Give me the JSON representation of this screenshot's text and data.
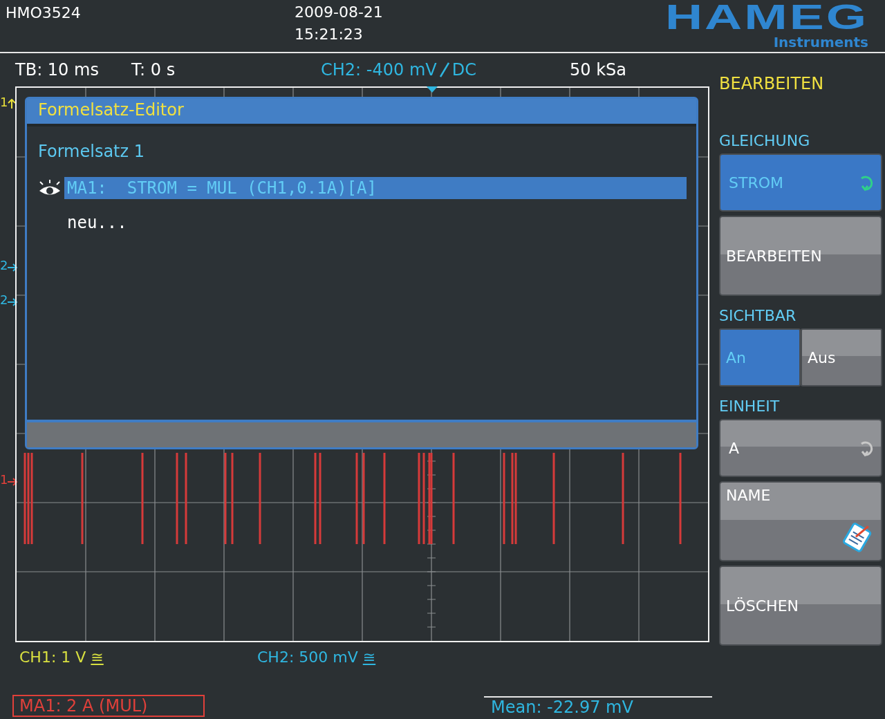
{
  "header": {
    "model": "HMO3524",
    "date": "2009-08-21",
    "time": "15:21:23",
    "logo": "HAMEG",
    "logo_sub": "Instruments"
  },
  "info": {
    "timebase": "TB: 10 ms",
    "trigger_time": "T: 0 s",
    "trigger_source": "CH2: -400 mV",
    "trigger_coupling": "DC",
    "sample_rate": "50 kSa"
  },
  "markers": [
    {
      "label": "1",
      "color": "#e8e03a",
      "kind": "up"
    },
    {
      "label": "2",
      "color": "#2fb6e0",
      "kind": "right"
    },
    {
      "label": "2",
      "color": "#2fb6e0",
      "kind": "right"
    },
    {
      "label": "1",
      "color": "#e2403a",
      "kind": "right"
    }
  ],
  "dialog": {
    "title": "Formelsatz-Editor",
    "group": "Formelsatz 1",
    "entries": [
      {
        "text": "MA1:  STROM = MUL (CH1,0.1A)[A]",
        "visible": true,
        "selected": true
      },
      {
        "text": "neu...",
        "visible": false,
        "selected": false
      }
    ]
  },
  "channels": [
    {
      "label": "CH1: 1 V",
      "coupling": "≅",
      "color": "#d8e040"
    },
    {
      "label": "CH2: 500 mV",
      "coupling": "≅",
      "color": "#2fb6e0"
    }
  ],
  "math": {
    "label": "MA1: 2 A (MUL)"
  },
  "measurement": {
    "label": "Mean: -22.97 mV"
  },
  "menu": {
    "title": "BEARBEITEN",
    "items": [
      {
        "kind": "select",
        "heading": "GLEICHUNG",
        "value": "STROM",
        "highlighted": true
      },
      {
        "kind": "button",
        "label": "BEARBEITEN"
      },
      {
        "kind": "toggle",
        "heading": "SICHTBAR",
        "options": [
          {
            "label": "An",
            "selected": true
          },
          {
            "label": "Aus",
            "selected": false
          }
        ]
      },
      {
        "kind": "select",
        "heading": "EINHEIT",
        "value": "A",
        "highlighted": false
      },
      {
        "kind": "edit",
        "label": "NAME"
      },
      {
        "kind": "button",
        "label": "LÖSCHEN"
      }
    ]
  }
}
